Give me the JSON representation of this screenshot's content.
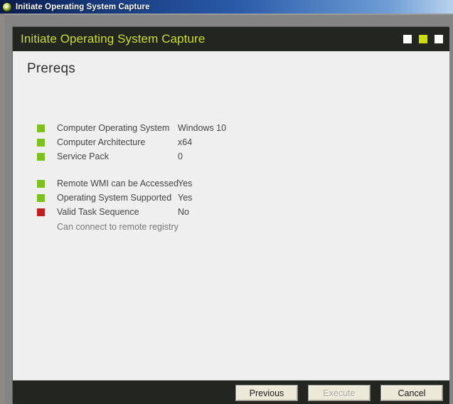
{
  "os_window": {
    "title": "Initiate Operating System Capture",
    "icon": "app-circle-icon"
  },
  "dialog": {
    "header_title": "Initiate Operating System Capture",
    "window_controls": [
      {
        "name": "minimize-box",
        "color": "#ffffff"
      },
      {
        "name": "maximize-box",
        "color": "#cbdd12"
      },
      {
        "name": "close-box",
        "color": "#ffffff"
      }
    ],
    "page_title": "Prereqs",
    "groups": [
      {
        "rows": [
          {
            "label": "Computer Operating System",
            "value": "Windows 10",
            "status": "ok"
          },
          {
            "label": "Computer Architecture",
            "value": "x64",
            "status": "ok"
          },
          {
            "label": "Service Pack",
            "value": "0",
            "status": "ok"
          }
        ]
      },
      {
        "rows": [
          {
            "label": "Remote WMI can be Accessed",
            "value": "Yes",
            "status": "ok"
          },
          {
            "label": "Operating System Supported",
            "value": "Yes",
            "status": "ok"
          },
          {
            "label": "Valid Task Sequence",
            "value": "No",
            "status": "fail"
          }
        ],
        "note": "Can connect to remote registry"
      }
    ],
    "buttons": [
      {
        "label": "Previous",
        "name": "previous-button",
        "disabled": false
      },
      {
        "label": "Execute",
        "name": "execute-button",
        "disabled": true
      },
      {
        "label": "Cancel",
        "name": "cancel-button",
        "disabled": false
      }
    ]
  },
  "colors": {
    "accent_green": "#cbdd33",
    "status_ok": "#7ec01e",
    "status_fail": "#c01f1f",
    "header_bg": "#232521",
    "titlebar_blue": "#2a5aa8"
  }
}
